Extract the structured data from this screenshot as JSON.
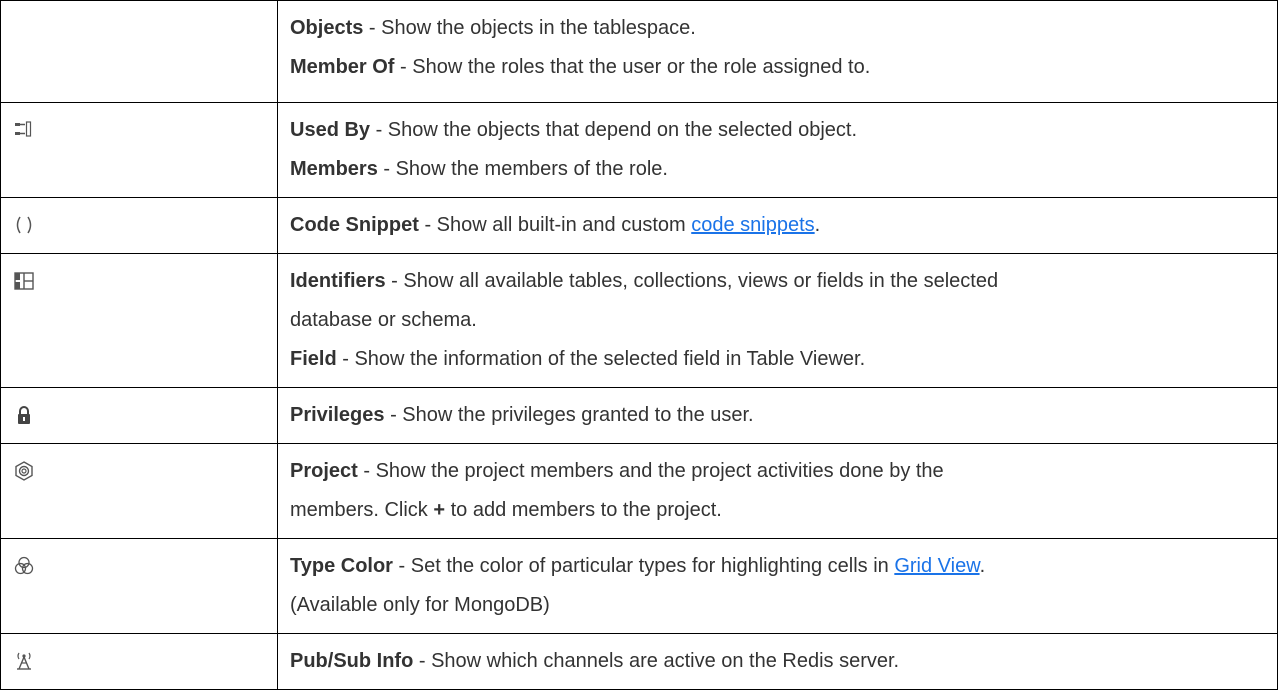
{
  "rows": [
    {
      "icon": null,
      "lines": [
        {
          "term": "Objects",
          "text": " - Show the objects in the tablespace."
        },
        {
          "term": "Member Of",
          "text": " - Show the roles that the user or the role assigned to."
        }
      ]
    },
    {
      "icon": "dependency-icon",
      "lines": [
        {
          "term": "Used By",
          "text": " - Show the objects that depend on the selected object."
        },
        {
          "term": "Members",
          "text": " - Show the members of the role."
        }
      ]
    },
    {
      "icon": "parentheses-icon",
      "lines": [
        {
          "term": "Code Snippet",
          "text": " - Show all built-in and custom ",
          "link": "code snippets",
          "after": "."
        }
      ]
    },
    {
      "icon": "grid-icon",
      "lines": [
        {
          "term": "Identifiers",
          "text": " - Show all available tables, collections, views or fields in the selected"
        },
        {
          "text": "database or schema."
        },
        {
          "term": "Field",
          "text": " - Show the information of the selected field in Table Viewer."
        }
      ]
    },
    {
      "icon": "lock-icon",
      "lines": [
        {
          "term": "Privileges",
          "text": " - Show the privileges granted to the user."
        }
      ]
    },
    {
      "icon": "hexagon-icon",
      "lines": [
        {
          "term": "Project",
          "text": " - Show the project members and the project activities done by the"
        },
        {
          "text": "members. Click ",
          "plus": "+",
          "after": " to add members to the project."
        }
      ]
    },
    {
      "icon": "color-circles-icon",
      "lines": [
        {
          "term": "Type Color",
          "text": " - Set the color of particular types for highlighting cells in ",
          "link": "Grid View",
          "after": "."
        },
        {
          "text": "(Available only for MongoDB)"
        }
      ]
    },
    {
      "icon": "antenna-icon",
      "lines": [
        {
          "term": "Pub/Sub Info",
          "text": " - Show which channels are active on the Redis server."
        }
      ]
    }
  ],
  "colors": {
    "text": "#333333",
    "link": "#1a73e8",
    "border": "#000000",
    "icon": "#555555"
  }
}
